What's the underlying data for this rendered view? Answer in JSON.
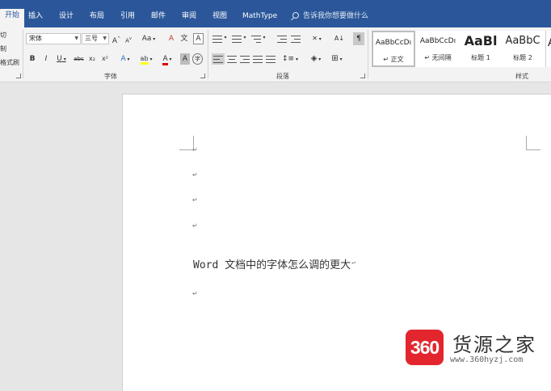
{
  "tabs": [
    {
      "label": "开始",
      "active": true
    },
    {
      "label": "插入"
    },
    {
      "label": "设计"
    },
    {
      "label": "布局"
    },
    {
      "label": "引用"
    },
    {
      "label": "邮件"
    },
    {
      "label": "审阅"
    },
    {
      "label": "视图"
    },
    {
      "label": "MathType"
    }
  ],
  "tell_me": "告诉我你想要做什么",
  "clipboard": {
    "cut": "切",
    "copy": "制",
    "format_painter": "格式刷"
  },
  "font": {
    "name": "宋体",
    "size": "三号",
    "grow": "A",
    "shrink": "A",
    "case": "Aa",
    "clear_format": "A",
    "phonetic": "文",
    "char_border": "A",
    "bold": "B",
    "italic": "I",
    "underline": "U",
    "strikethrough": "abc",
    "subscript": "x₂",
    "superscript": "x²",
    "text_effects": "A",
    "highlight": "ab",
    "font_color": "A",
    "char_shading": "A",
    "enclose": "字",
    "group_label": "字体"
  },
  "paragraph": {
    "group_label": "段落",
    "sort": "A↓",
    "show_marks": "¶"
  },
  "styles": {
    "group_label": "样式",
    "items": [
      {
        "preview": "AaBbCcDı",
        "name": "↵ 正文",
        "selected": true
      },
      {
        "preview": "AaBbCcDı",
        "name": "↵ 无间隔"
      },
      {
        "preview": "AaBl",
        "name": "标题 1"
      },
      {
        "preview": "AaBbC",
        "name": "标题 2"
      }
    ]
  },
  "document": {
    "paragraph_mark": "↵",
    "text": "Word 文档中的字体怎么调的更大"
  },
  "watermark": {
    "badge": "360",
    "name": "货源之家",
    "url": "www.360hyzj.com"
  },
  "colors": {
    "ribbon_blue": "#2b579a",
    "watermark_red": "#e3262e",
    "highlight_yellow": "#ffff00",
    "font_red": "#e00000"
  }
}
